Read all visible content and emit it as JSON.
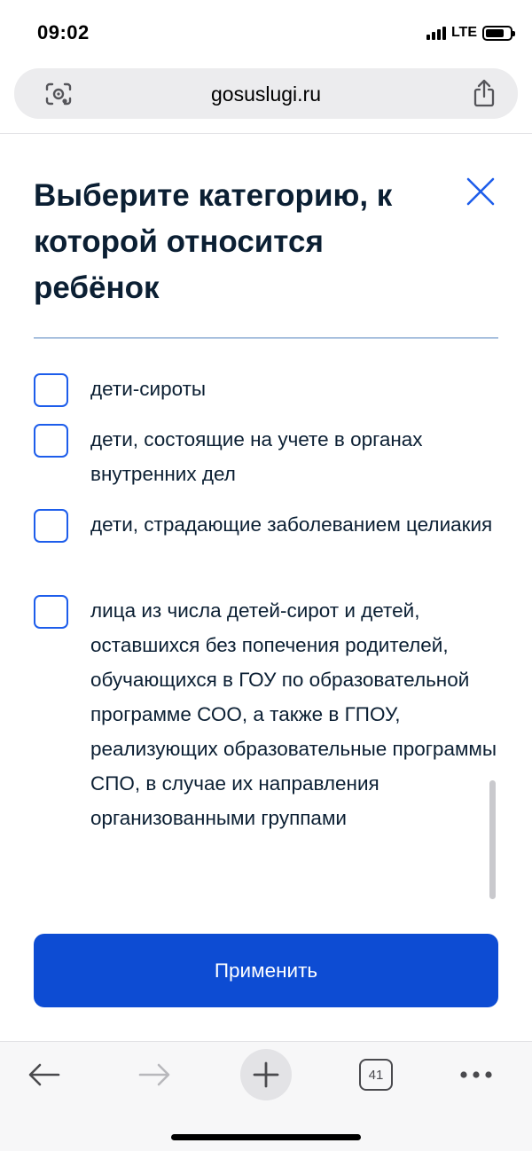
{
  "status_bar": {
    "time": "09:02",
    "network": "LTE",
    "icons": [
      "signal-icon",
      "battery-icon"
    ]
  },
  "browser": {
    "url": "gosuslugi.ru",
    "icons": [
      "lens-icon",
      "share-icon"
    ]
  },
  "modal": {
    "title": "Выберите категорию, к которой относится ребёнок",
    "close_icon": "close-icon",
    "options": [
      {
        "label": "дети-сироты",
        "checked": false
      },
      {
        "label": "дети, состоящие на учете в органах внутренних дел",
        "checked": false
      },
      {
        "label": "дети, страдающие заболеванием целиакия",
        "checked": false
      },
      {
        "label": "лица из числа детей-сирот и детей, оставшихся без попечения родителей, обучающихся в ГОУ по образовательной программе СОО, а также в ГПОУ, реализующих образовательные программы СПО, в случае их направления организованными группами",
        "checked": false
      }
    ],
    "apply_label": "Применить"
  },
  "toolbar": {
    "tabs_count": "41",
    "icons": [
      "back-arrow-icon",
      "forward-arrow-icon",
      "plus-icon",
      "tabs-icon",
      "more-icon"
    ]
  },
  "colors": {
    "primary": "#0d4cd3",
    "checkbox_border": "#1d5deb",
    "text": "#0b1f33",
    "rule": "#a8c0de"
  }
}
